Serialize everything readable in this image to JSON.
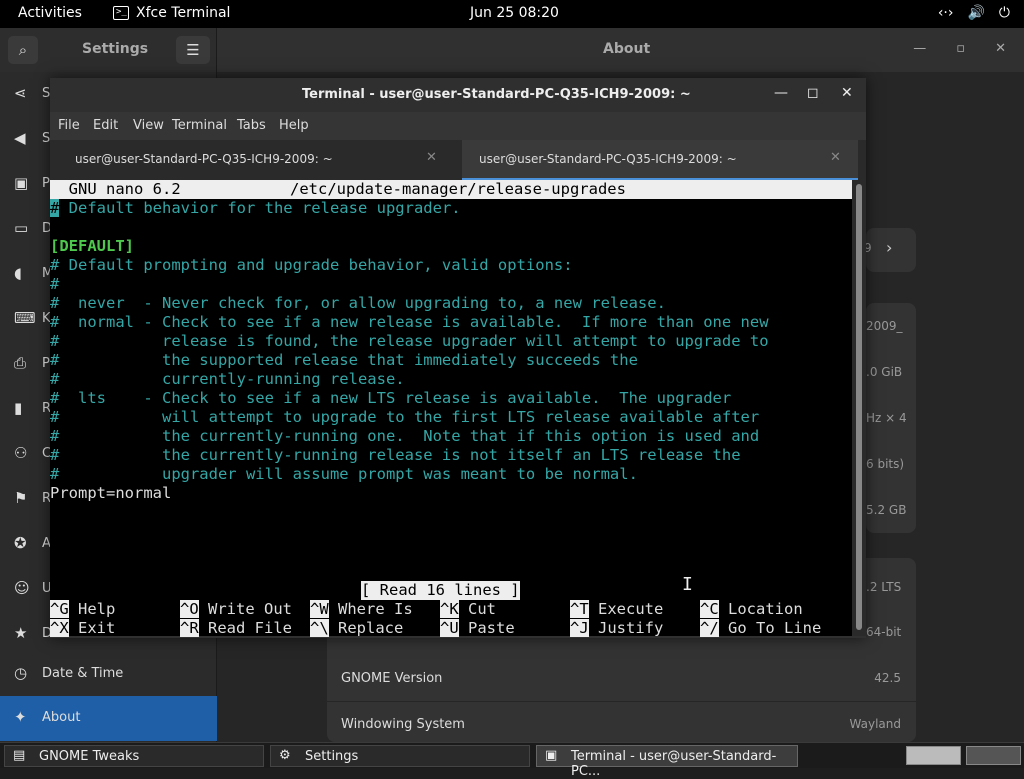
{
  "topbar": {
    "activities": "Activities",
    "app_name": "Xfce Terminal",
    "clock": "Jun 25  08:20",
    "tray": [
      "network-icon",
      "volume-icon",
      "power-icon"
    ]
  },
  "settings": {
    "title": "Settings",
    "page_title": "About",
    "sidebar": [
      {
        "icon": "share-icon",
        "label": "S"
      },
      {
        "icon": "sound-icon",
        "label": "S"
      },
      {
        "icon": "power-icon",
        "label": "P"
      },
      {
        "icon": "display-icon",
        "label": "D"
      },
      {
        "icon": "mouse-icon",
        "label": "M"
      },
      {
        "icon": "keyboard-icon",
        "label": "K"
      },
      {
        "icon": "printer-icon",
        "label": "P"
      },
      {
        "icon": "removable-media-icon",
        "label": "R"
      },
      {
        "icon": "color-icon",
        "label": "C"
      },
      {
        "icon": "region-icon",
        "label": "R"
      },
      {
        "icon": "accessibility-icon",
        "label": "A"
      },
      {
        "icon": "users-icon",
        "label": "U"
      },
      {
        "icon": "default-apps-icon",
        "label": "D"
      },
      {
        "icon": "clock-icon",
        "label": "Date & Time"
      },
      {
        "icon": "about-icon",
        "label": "About"
      }
    ],
    "device_name_partial": "9",
    "rows_partial": [
      "2009_",
      ".0 GiB",
      "Hz × 4",
      "6 bits)",
      "5.2 GB",
      ".2 LTS",
      "64-bit"
    ],
    "gnome_version_label": "GNOME Version",
    "gnome_version_value": "42.5",
    "windowing_label": "Windowing System",
    "windowing_value": "Wayland"
  },
  "terminal": {
    "window_title": "Terminal - user@user-Standard-PC-Q35-ICH9-2009: ~",
    "menu": [
      "File",
      "Edit",
      "View",
      "Terminal",
      "Tabs",
      "Help"
    ],
    "tabs": [
      {
        "label": "user@user-Standard-PC-Q35-ICH9-2009: ~",
        "active": false
      },
      {
        "label": "user@user-Standard-PC-Q35-ICH9-2009: ~",
        "active": true
      }
    ],
    "nano": {
      "header_left": "  GNU nano 6.2",
      "header_file": "/etc/update-manager/release-upgrades",
      "lines": [
        " Default behavior for the release upgrader.",
        "",
        "[DEFAULT]",
        "# Default prompting and upgrade behavior, valid options:",
        "#",
        "#  never  - Never check for, or allow upgrading to, a new release.",
        "#  normal - Check to see if a new release is available.  If more than one new",
        "#           release is found, the release upgrader will attempt to upgrade to",
        "#           the supported release that immediately succeeds the",
        "#           currently-running release.",
        "#  lts    - Check to see if a new LTS release is available.  The upgrader",
        "#           will attempt to upgrade to the first LTS release available after",
        "#           the currently-running one.  Note that if this option is used and",
        "#           the currently-running release is not itself an LTS release the",
        "#           upgrader will assume prompt was meant to be normal.",
        "Prompt=normal"
      ],
      "status": "[ Read 16 lines ]",
      "shortcuts_row1": [
        {
          "key": "^G",
          "label": "Help"
        },
        {
          "key": "^O",
          "label": "Write Out"
        },
        {
          "key": "^W",
          "label": "Where Is"
        },
        {
          "key": "^K",
          "label": "Cut"
        },
        {
          "key": "^T",
          "label": "Execute"
        },
        {
          "key": "^C",
          "label": "Location"
        }
      ],
      "shortcuts_row2": [
        {
          "key": "^X",
          "label": "Exit"
        },
        {
          "key": "^R",
          "label": "Read File"
        },
        {
          "key": "^\\",
          "label": "Replace"
        },
        {
          "key": "^U",
          "label": "Paste"
        },
        {
          "key": "^J",
          "label": "Justify"
        },
        {
          "key": "^/",
          "label": "Go To Line"
        }
      ]
    }
  },
  "taskbar": {
    "tasks": [
      {
        "label": "GNOME Tweaks",
        "icon": "tweaks-icon"
      },
      {
        "label": "Settings",
        "icon": "gear-icon"
      },
      {
        "label": "Terminal - user@user-Standard-PC...",
        "icon": "terminal-icon"
      }
    ]
  },
  "colors": {
    "comment": "#35a6a6",
    "section": "#4ec94e",
    "accent": "#1f5fa8"
  }
}
